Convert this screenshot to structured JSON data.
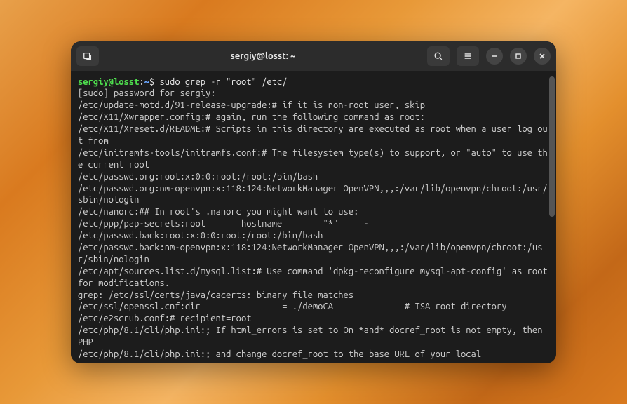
{
  "titlebar": {
    "title": "sergiy@losst: ~"
  },
  "prompt": {
    "user": "sergiy@losst",
    "sep1": ":",
    "path": "~",
    "sep2": "$ "
  },
  "command": "sudo grep -r \"root\" /etc/",
  "lines": [
    "[sudo] password for sergiy:",
    "/etc/update-motd.d/91-release-upgrade:# if it is non-root user, skip",
    "/etc/X11/Xwrapper.config:# again, run the following command as root:",
    "/etc/X11/Xreset.d/README:# Scripts in this directory are executed as root when a user log out from",
    "/etc/initramfs-tools/initramfs.conf:# The filesystem type(s) to support, or \"auto\" to use the current root",
    "/etc/passwd.org:root:x:0:0:root:/root:/bin/bash",
    "/etc/passwd.org:nm-openvpn:x:118:124:NetworkManager OpenVPN,,,:/var/lib/openvpn/chroot:/usr/sbin/nologin",
    "/etc/nanorc:## In root's .nanorc you might want to use:",
    "/etc/ppp/pap-secrets:root       hostname        \"*\"     -",
    "/etc/passwd.back:root:x:0:0:root:/root:/bin/bash",
    "/etc/passwd.back:nm-openvpn:x:118:124:NetworkManager OpenVPN,,,:/var/lib/openvpn/chroot:/usr/sbin/nologin",
    "/etc/apt/sources.list.d/mysql.list:# Use command 'dpkg-reconfigure mysql-apt-config' as root for modifications.",
    "grep: /etc/ssl/certs/java/cacerts: binary file matches",
    "/etc/ssl/openssl.cnf:dir                = ./demoCA              # TSA root directory",
    "/etc/e2scrub.conf:# recipient=root",
    "/etc/php/8.1/cli/php.ini:; If html_errors is set to On *and* docref_root is not empty, then PHP",
    "/etc/php/8.1/cli/php.ini:; and change docref_root to the base URL of your local"
  ]
}
